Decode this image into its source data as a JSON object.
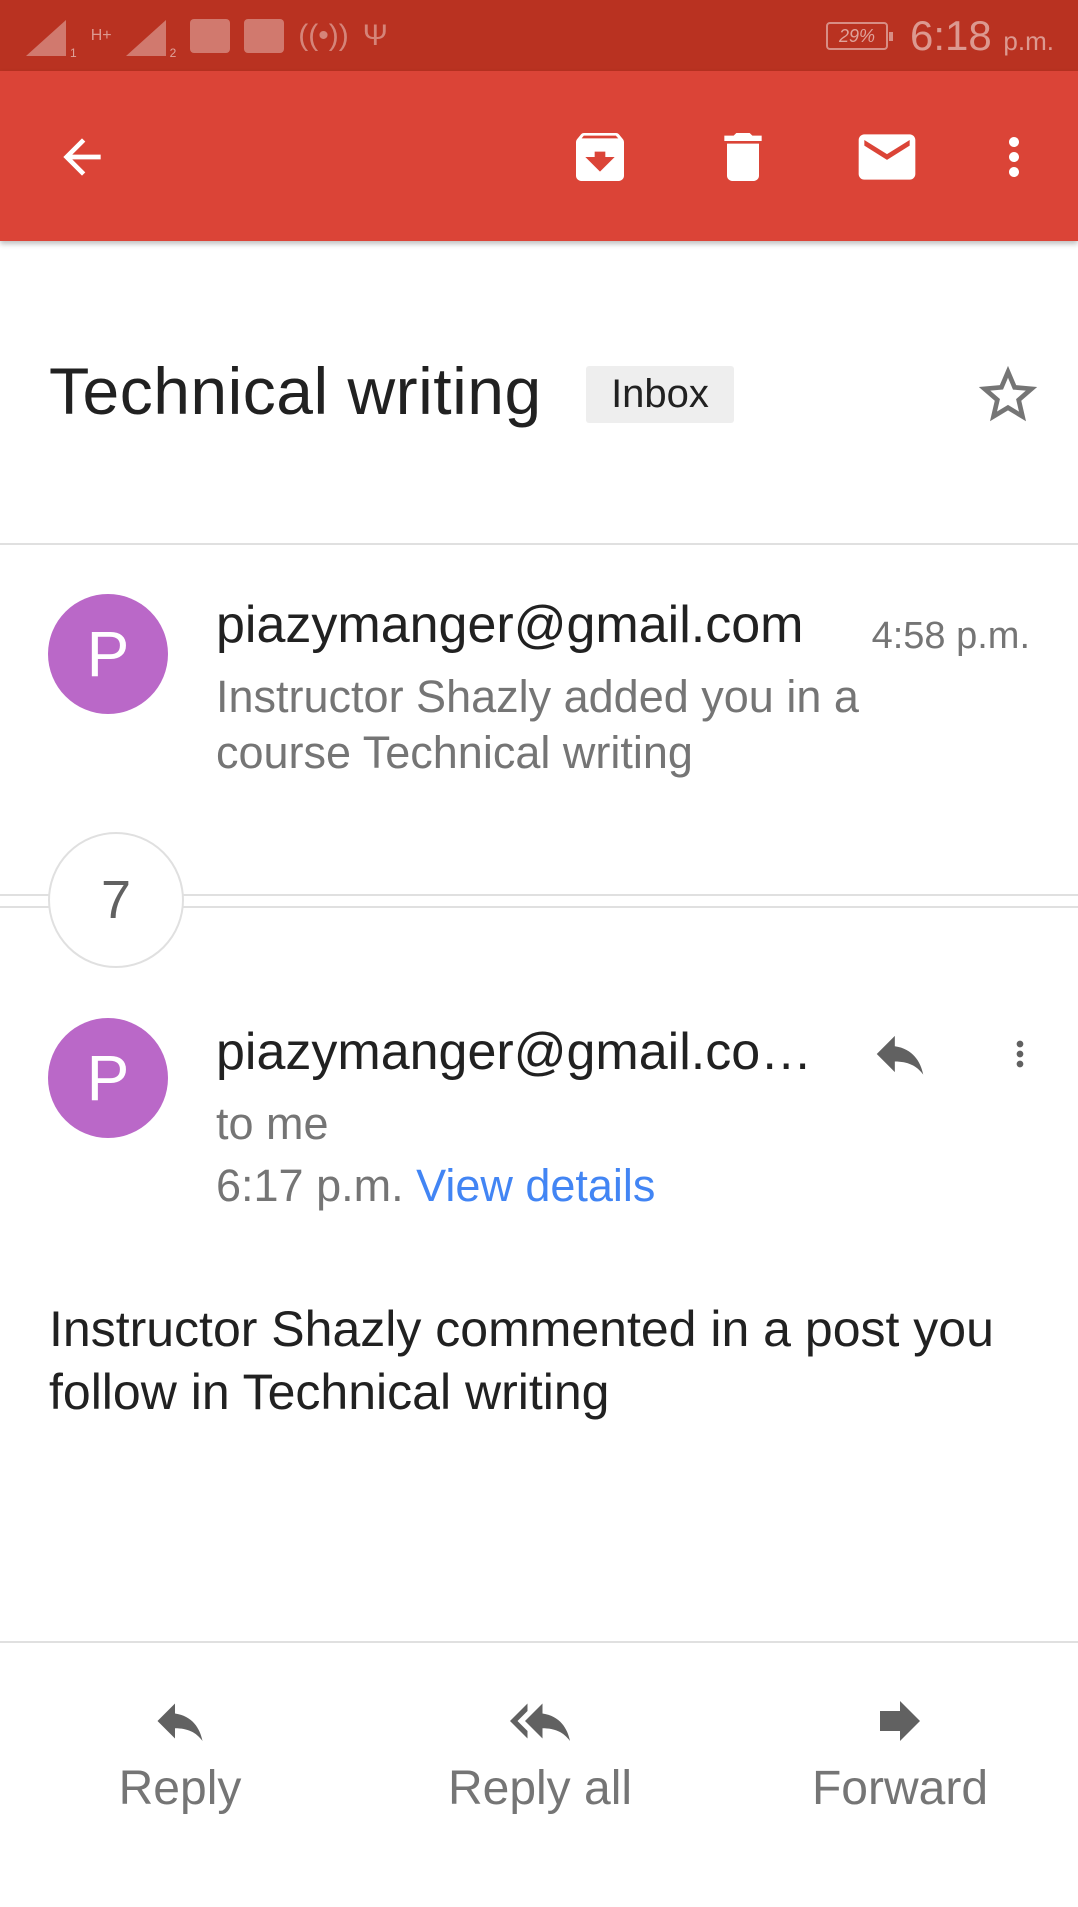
{
  "status_bar": {
    "network_type": "H+",
    "sim1_index": "1",
    "sim2_index": "2",
    "battery": "29%",
    "time": "6:18",
    "time_suffix": "p.m."
  },
  "toolbar": {
    "icons": [
      "back-arrow-icon",
      "archive-icon",
      "delete-icon",
      "mark-unread-icon",
      "more-vert-icon"
    ],
    "color": "#db4437"
  },
  "thread": {
    "subject": "Technical writing",
    "label": "Inbox",
    "collapsed_count": "7"
  },
  "messages": [
    {
      "avatar_letter": "P",
      "sender": "piazymanger@gmail.com",
      "time": "4:58 p.m.",
      "snippet": "Instructor Shazly added you in a course Technical writing"
    },
    {
      "avatar_letter": "P",
      "sender": "piazymanger@gmail.co…",
      "recipient": "to me",
      "time": "6:17 p.m.",
      "view_details": "View details",
      "body": "Instructor Shazly commented in a post you follow in Technical writing"
    }
  ],
  "actions": {
    "reply": "Reply",
    "reply_all": "Reply all",
    "forward": "Forward"
  },
  "colors": {
    "status_bar": "#b93221",
    "avatar": "#ba68c8",
    "link": "#4285f4"
  }
}
